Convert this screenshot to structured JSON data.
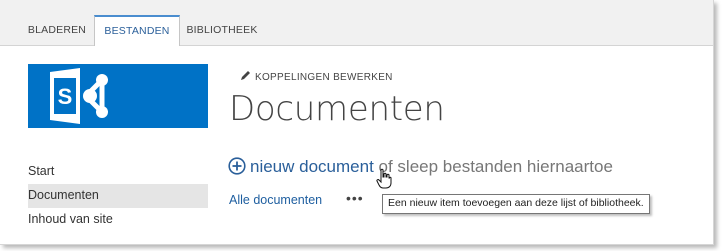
{
  "ribbon": {
    "tabs": [
      {
        "label": "BLADEREN",
        "active": false
      },
      {
        "label": "BESTANDEN",
        "active": true
      },
      {
        "label": "BIBLIOTHEEK",
        "active": false
      }
    ]
  },
  "site": {
    "logo_icon": "sharepoint-logo-icon",
    "logo_color": "#0072c6",
    "edit_links_label": "KOPPELINGEN BEWERKEN",
    "page_title": "Documenten"
  },
  "quick_launch": {
    "items": [
      {
        "label": "Start",
        "selected": false
      },
      {
        "label": "Documenten",
        "selected": true
      },
      {
        "label": "Inhoud van site",
        "selected": false
      }
    ]
  },
  "library": {
    "new_document_link": "nieuw document",
    "drag_text": " of sleep bestanden hiernaartoe",
    "view_label": "Alle documenten",
    "more_label": "•••",
    "tooltip": "Een nieuw item toevoegen aan deze lijst of bibliotheek."
  },
  "colors": {
    "accent": "#0072c6",
    "link": "#2a5f9a",
    "tab_active_border": "#4a8dcf"
  }
}
